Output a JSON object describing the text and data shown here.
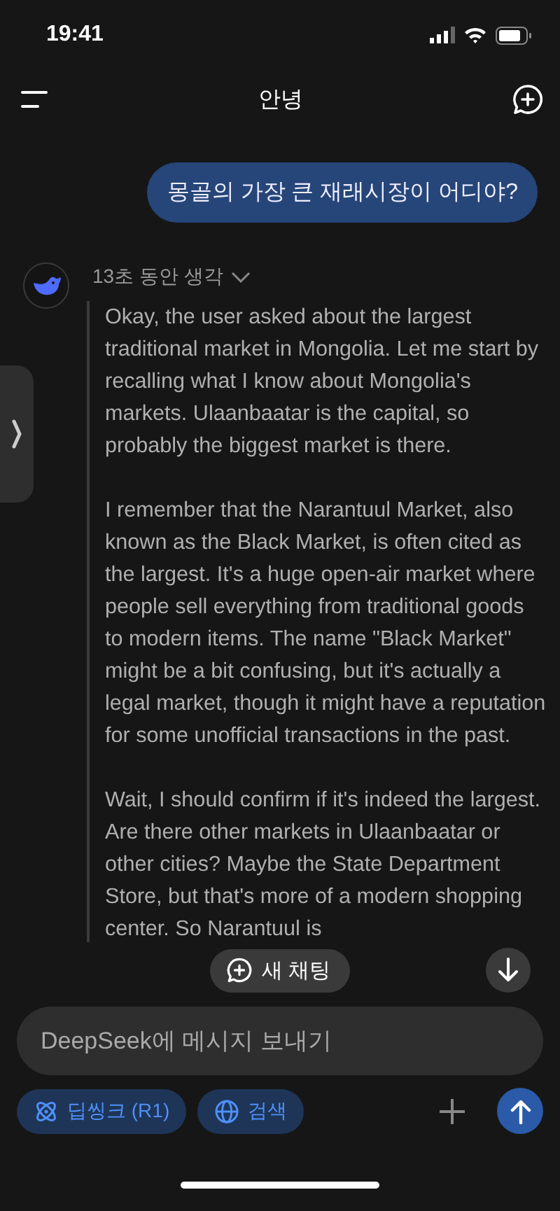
{
  "status_bar": {
    "time": "19:41"
  },
  "header": {
    "title": "안녕"
  },
  "user_message": "몽골의 가장 큰 재래시장이 어디야?",
  "thinking": {
    "label": "13초 동안 생각",
    "paragraphs": [
      "Okay, the user asked about the largest traditional market in Mongolia. Let me start by recalling what I know about Mongolia's markets. Ulaanbaatar is the capital, so probably the biggest market is there.",
      "I remember that the Narantuul Market, also known as the Black Market, is often cited as the largest. It's a huge open-air market where people sell everything from traditional goods to modern items. The name \"Black Market\" might be a bit confusing, but it's actually a legal market, though it might have a reputation for some unofficial transactions in the past.",
      "Wait, I should confirm if it's indeed the largest. Are there other markets in Ulaanbaatar or other cities? Maybe the State Department Store, but that's more of a modern shopping center. So Narantuul is"
    ]
  },
  "new_chat_button": "새 채팅",
  "composer": {
    "placeholder": "DeepSeek에 메시지 보내기",
    "toggles": [
      {
        "label": "딥씽크 (R1)",
        "kind": "deepthink",
        "selected": true
      },
      {
        "label": "검색",
        "kind": "search",
        "selected": true
      }
    ]
  }
}
